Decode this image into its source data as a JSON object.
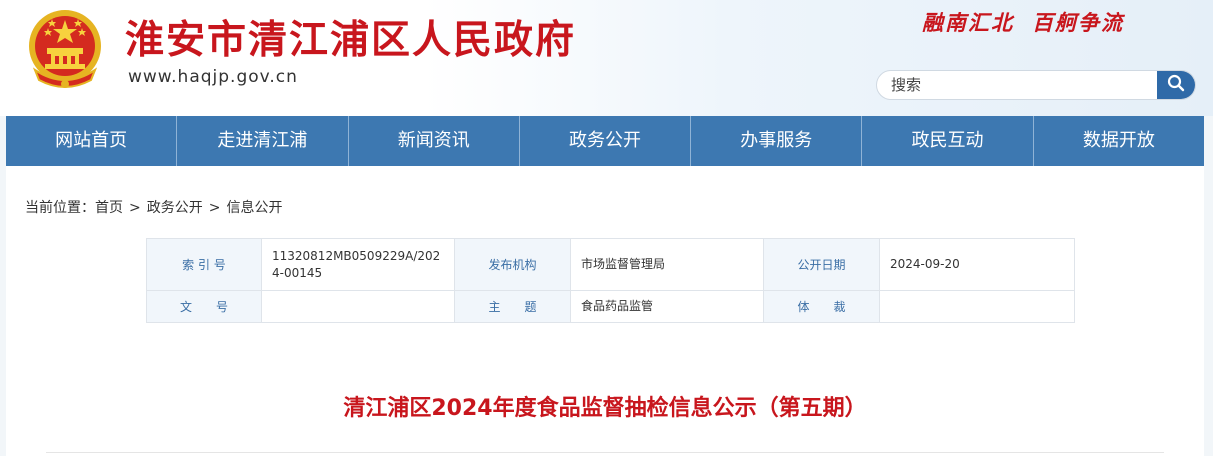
{
  "header": {
    "site_title": "淮安市清江浦区人民政府",
    "site_url": "www.haqjp.gov.cn",
    "slogan_left": "融南汇北",
    "slogan_right": "百舸争流",
    "search": {
      "placeholder": "搜索"
    }
  },
  "nav": {
    "items": [
      {
        "label": "网站首页"
      },
      {
        "label": "走进清江浦"
      },
      {
        "label": "新闻资讯"
      },
      {
        "label": "政务公开"
      },
      {
        "label": "办事服务"
      },
      {
        "label": "政民互动"
      },
      {
        "label": "数据开放"
      }
    ]
  },
  "breadcrumb": {
    "prefix": "当前位置：",
    "items": [
      "首页",
      "政务公开",
      "信息公开"
    ],
    "separator": ">"
  },
  "meta": {
    "index_label": "索 引 号",
    "index_value": "11320812MB0509229A/2024-00145",
    "publisher_label": "发布机构",
    "publisher_value": "市场监督管理局",
    "date_label": "公开日期",
    "date_value": "2024-09-20",
    "docno_label": "文　　号",
    "docno_value": "",
    "subject_label": "主　　题",
    "subject_value": "食品药品监管",
    "genre_label": "体　　裁",
    "genre_value": ""
  },
  "article": {
    "title": "清江浦区2024年度食品监督抽检信息公示（第五期）"
  },
  "colors": {
    "brand_red": "#c8161d",
    "nav_blue": "#3d78b1",
    "search_button": "#2f6aa8",
    "label_blue": "#3a6ea5"
  },
  "icons": {
    "emblem": "national-emblem-icon",
    "search": "search-icon"
  }
}
